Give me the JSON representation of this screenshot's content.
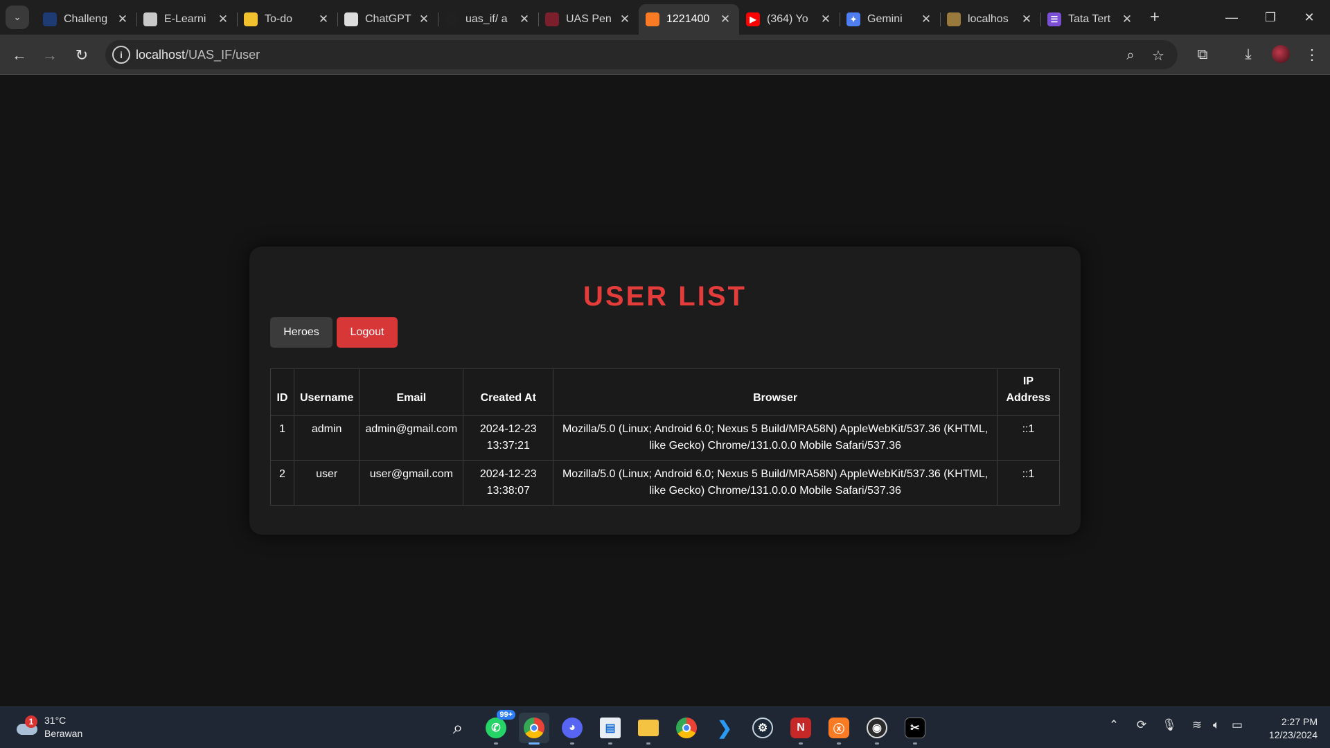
{
  "browser": {
    "tabs": [
      {
        "title": "Challeng",
        "icon": "generic-page-icon",
        "color": "#1f3b73",
        "glyph": ""
      },
      {
        "title": "E-Learni",
        "icon": "elearning-icon",
        "color": "#c9c9c9",
        "glyph": ""
      },
      {
        "title": "To-do",
        "icon": "todo-icon",
        "color": "#f2c12e",
        "glyph": ""
      },
      {
        "title": "ChatGPT",
        "icon": "chatgpt-icon",
        "color": "#dddddd",
        "glyph": ""
      },
      {
        "title": "uas_if/ a",
        "icon": "github-icon",
        "color": "#202020",
        "glyph": ""
      },
      {
        "title": "UAS Pen",
        "icon": "uas-icon",
        "color": "#7a1f2b",
        "glyph": ""
      },
      {
        "title": "1221400",
        "icon": "xampp-icon",
        "color": "#fb7a24",
        "glyph": "",
        "active": true
      },
      {
        "title": "(364) Yo",
        "icon": "youtube-icon",
        "color": "#ff0000",
        "glyph": "▶"
      },
      {
        "title": "Gemini",
        "icon": "gemini-icon",
        "color": "#4f7df3",
        "glyph": "✦"
      },
      {
        "title": "localhos",
        "icon": "localhost-icon",
        "color": "#9a7a3c",
        "glyph": ""
      },
      {
        "title": "Tata Tert",
        "icon": "list-icon",
        "color": "#7b4fd6",
        "glyph": "☰"
      }
    ],
    "url_host": "localhost",
    "url_path": "/UAS_IF/user"
  },
  "page": {
    "title": "USER LIST",
    "heroes_label": "Heroes",
    "logout_label": "Logout",
    "columns": [
      "ID",
      "Username",
      "Email",
      "Created At",
      "Browser",
      "IP Address"
    ],
    "rows": [
      {
        "id": "1",
        "username": "admin",
        "email": "admin@gmail.com",
        "created_at": "2024-12-23 13:37:21",
        "browser": "Mozilla/5.0 (Linux; Android 6.0; Nexus 5 Build/MRA58N) AppleWebKit/537.36 (KHTML, like Gecko) Chrome/131.0.0.0 Mobile Safari/537.36",
        "ip": "::1"
      },
      {
        "id": "2",
        "username": "user",
        "email": "user@gmail.com",
        "created_at": "2024-12-23 13:38:07",
        "browser": "Mozilla/5.0 (Linux; Android 6.0; Nexus 5 Build/MRA58N) AppleWebKit/537.36 (KHTML, like Gecko) Chrome/131.0.0.0 Mobile Safari/537.36",
        "ip": "::1"
      }
    ]
  },
  "taskbar": {
    "weather_temp": "31°C",
    "weather_desc": "Berawan",
    "weather_badge": "1",
    "whatsapp_badge": "99+",
    "time": "2:27 PM",
    "date": "12/23/2024"
  },
  "colors": {
    "accent_red": "#e43b3b",
    "logout_red": "#d73737",
    "background": "#141414",
    "card": "#1c1c1c"
  }
}
